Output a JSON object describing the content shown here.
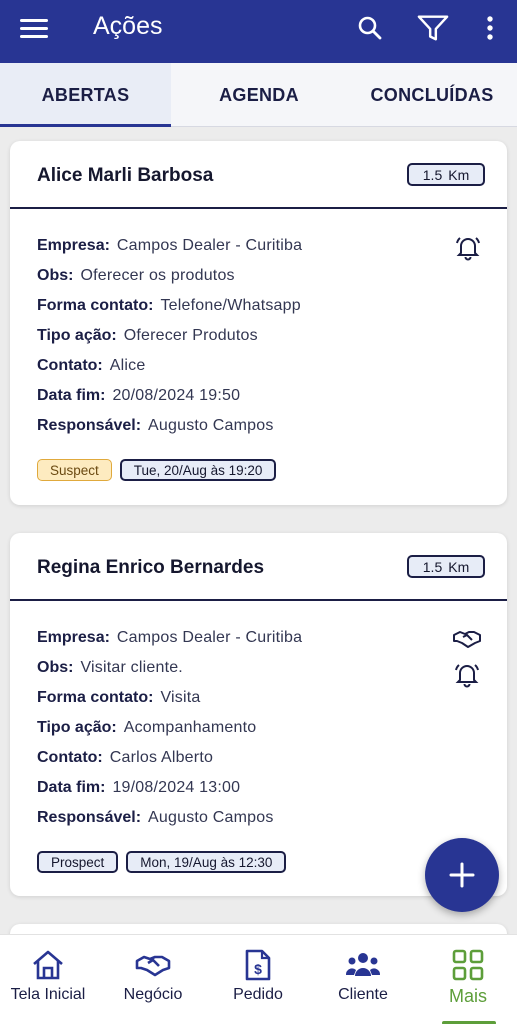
{
  "appbar": {
    "title": "Ações",
    "color": "#283593"
  },
  "tabs": [
    {
      "label": "ABERTAS",
      "active": true
    },
    {
      "label": "AGENDA",
      "active": false
    },
    {
      "label": "CONCLUÍDAS",
      "active": false
    }
  ],
  "labels": {
    "empresa": "Empresa:",
    "obs": "Obs:",
    "forma": "Forma contato:",
    "tipo": "Tipo ação:",
    "contato": "Contato:",
    "datafim": "Data fim:",
    "responsavel": "Responsável:",
    "km": "Km"
  },
  "cards": [
    {
      "name": "Alice Marli Barbosa",
      "distance": "1.5",
      "empresa": "Campos Dealer - Curitiba",
      "obs": "Oferecer os produtos",
      "forma_contato": "Telefone/Whatsapp",
      "tipo_acao": "Oferecer Produtos",
      "contato": "Alice",
      "data_fim": "20/08/2024 19:50",
      "responsavel": "Augusto Campos",
      "status": "Suspect",
      "date_badge": "Tue, 20/Aug às 19:20",
      "icons": [
        "bell-icon"
      ]
    },
    {
      "name": "Regina Enrico Bernardes",
      "distance": "1.5",
      "empresa": "Campos Dealer - Curitiba",
      "obs": "Visitar cliente.",
      "forma_contato": "Visita",
      "tipo_acao": "Acompanhamento",
      "contato": "Carlos Alberto",
      "data_fim": "19/08/2024 13:00",
      "responsavel": "Augusto Campos",
      "status": "Prospect",
      "date_badge": "Mon, 19/Aug às 12:30",
      "icons": [
        "handshake-icon",
        "bell-icon"
      ]
    }
  ],
  "nav": [
    {
      "label": "Tela Inicial",
      "icon": "home-icon"
    },
    {
      "label": "Negócio",
      "icon": "handshake-icon"
    },
    {
      "label": "Pedido",
      "icon": "document-dollar-icon"
    },
    {
      "label": "Cliente",
      "icon": "users-icon"
    },
    {
      "label": "Mais",
      "icon": "grid-icon",
      "active": true
    }
  ],
  "colors": {
    "primary": "#283593",
    "accent_green": "#5d9e3a",
    "suspect_bg": "#fdebc0",
    "suspect_border": "#e0a93c"
  }
}
